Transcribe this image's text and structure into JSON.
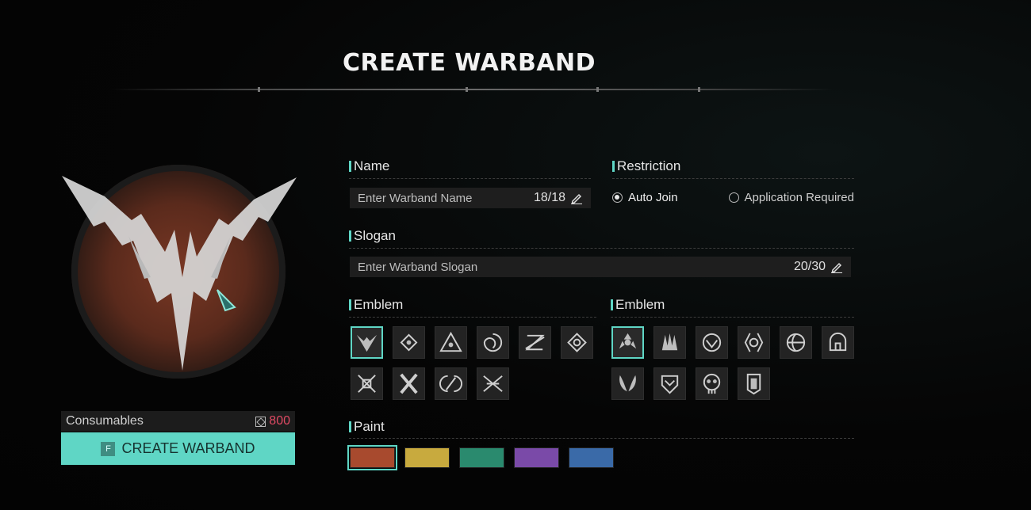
{
  "header": {
    "title": "CREATE WARBAND"
  },
  "consumables": {
    "label": "Consumables",
    "cost": "800",
    "cost_icon": "currency-icon"
  },
  "create_button": {
    "key": "F",
    "label": "CREATE WARBAND"
  },
  "name": {
    "label": "Name",
    "placeholder": "Enter Warband Name",
    "count": "18/18"
  },
  "restriction": {
    "label": "Restriction",
    "options": [
      {
        "label": "Auto Join",
        "selected": true
      },
      {
        "label": "Application Required",
        "selected": false
      }
    ]
  },
  "slogan": {
    "label": "Slogan",
    "placeholder": "Enter Warband Slogan",
    "count": "20/30"
  },
  "emblem_left": {
    "label": "Emblem",
    "icons": [
      "wings-v-icon",
      "diamond-target-icon",
      "pyramid-eye-icon",
      "spiral-icon",
      "z-slash-icon",
      "diamond-eye-icon",
      "crossed-swords-icon",
      "crossed-bones-icon",
      "broken-ring-icon",
      "crossed-blades-icon"
    ],
    "selected_index": 0
  },
  "emblem_right": {
    "label": "Emblem",
    "icons": [
      "radiation-icon",
      "claw-marks-icon",
      "winged-shield-icon",
      "crescent-pair-icon",
      "globe-icon",
      "helmet-icon",
      "feather-wings-icon",
      "chevron-shield-icon",
      "round-skull-icon",
      "banner-shield-icon"
    ],
    "selected_index": 0
  },
  "paint": {
    "label": "Paint",
    "colors": [
      "#a84a2e",
      "#c8aa3e",
      "#2a8a6e",
      "#7a4aa8",
      "#3a6aa8"
    ],
    "selected_index": 0
  },
  "accent": "#5fd6c5"
}
